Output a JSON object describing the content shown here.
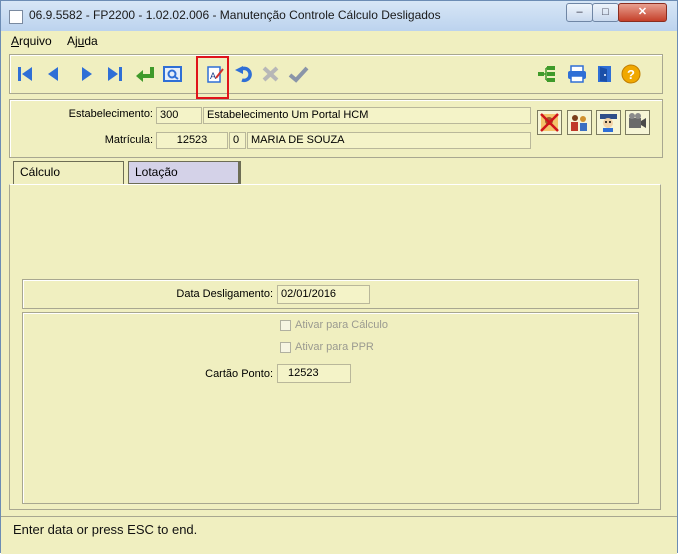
{
  "window": {
    "title": "06.9.5582 - FP2200 - 1.02.02.006 - Manutenção Controle Cálculo Desligados",
    "minimize_label": "–",
    "maximize_label": "□",
    "close_label": "✕"
  },
  "menu": {
    "arquivo_first": "A",
    "arquivo_rest": "rquivo",
    "ajuda_first": "Aj",
    "ajuda_u": "u",
    "ajuda_rest": "da"
  },
  "header": {
    "estabelecimento_label": "Estabelecimento:",
    "estabelecimento_code": "300",
    "estabelecimento_name": "Estabelecimento Um Portal HCM",
    "matricula_label": "Matrícula:",
    "matricula_value": "12523",
    "matricula_digit": "0",
    "employee_name": "MARIA DE SOUZA"
  },
  "tabs": {
    "calculo": "Cálculo",
    "lotacao": "Lotação"
  },
  "form": {
    "data_desligamento_label": "Data Desligamento:",
    "data_desligamento_value": "02/01/2016",
    "ativar_calculo_label": "Ativar para Cálculo",
    "ativar_ppr_label": "Ativar para PPR",
    "cartao_ponto_label": "Cartão Ponto:",
    "cartao_ponto_value": "12523"
  },
  "status": {
    "text": "Enter data or press ESC to end."
  },
  "colors": {
    "background": "#f0efc0",
    "nav_blue": "#2f6fd6",
    "highlight_red": "#e0141a"
  }
}
